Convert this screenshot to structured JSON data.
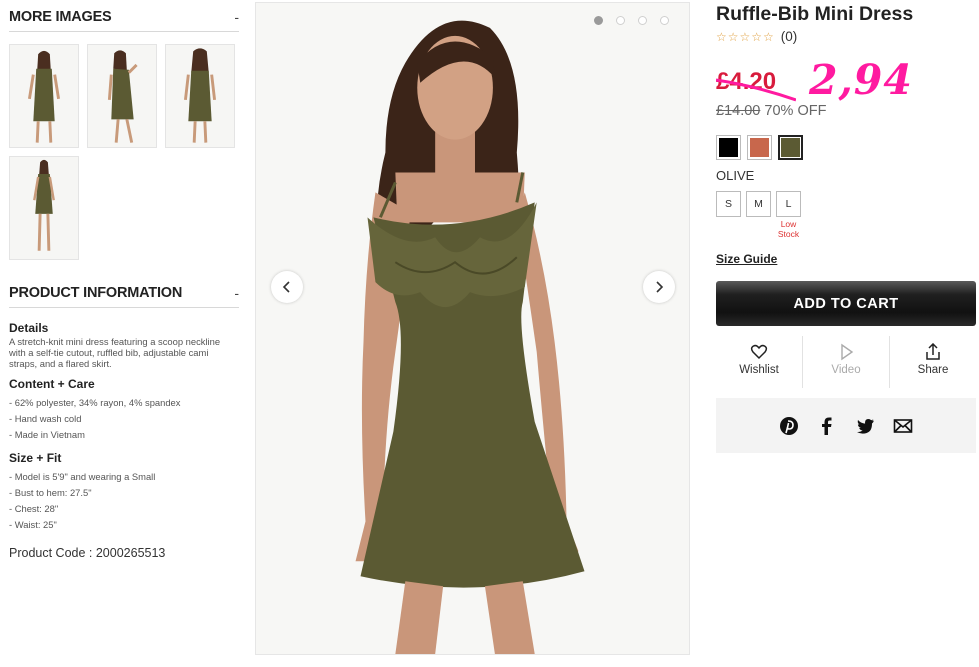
{
  "left": {
    "more_images": {
      "title": "MORE IMAGES",
      "toggle": "-"
    },
    "product_information": {
      "title": "PRODUCT INFORMATION",
      "toggle": "-"
    },
    "details": {
      "heading": "Details",
      "text": "A stretch-knit mini dress featuring a scoop neckline with a self-tie cutout, ruffled bib, adjustable cami straps, and a flared skirt."
    },
    "content_care": {
      "heading": "Content + Care",
      "items": [
        "- 62% polyester, 34% rayon, 4% spandex",
        "- Hand wash cold",
        "- Made in Vietnam"
      ]
    },
    "size_fit": {
      "heading": "Size + Fit",
      "items": [
        "- Model is 5'9\" and wearing a Small",
        "- Bust to hem: 27.5\"",
        "- Chest: 28\"",
        "- Waist: 25\""
      ]
    },
    "product_code": "Product Code : 2000265513"
  },
  "gallery": {
    "active_index": 0,
    "dot_count": 4
  },
  "product": {
    "title": "Ruffle-Bib Mini Dress",
    "rating_count": "(0)",
    "sale_price": "£4.20",
    "handwritten_price": "2,94",
    "original_price": "£14.00",
    "discount": "70% OFF",
    "colors": [
      {
        "name": "black",
        "hex": "#000000"
      },
      {
        "name": "rust",
        "hex": "#c8674c"
      },
      {
        "name": "olive",
        "hex": "#5b5a33"
      }
    ],
    "selected_color": "OLIVE",
    "sizes": [
      "S",
      "M",
      "L"
    ],
    "low_stock_label": "Low Stock",
    "size_guide": "Size Guide",
    "add_to_cart": "ADD TO CART",
    "actions": {
      "wishlist": "Wishlist",
      "video": "Video",
      "share": "Share"
    }
  },
  "colors": {
    "sale_red": "#d81b3c",
    "pink_annotation": "#ff1aa0",
    "olive_dress": "#5b5a33"
  }
}
